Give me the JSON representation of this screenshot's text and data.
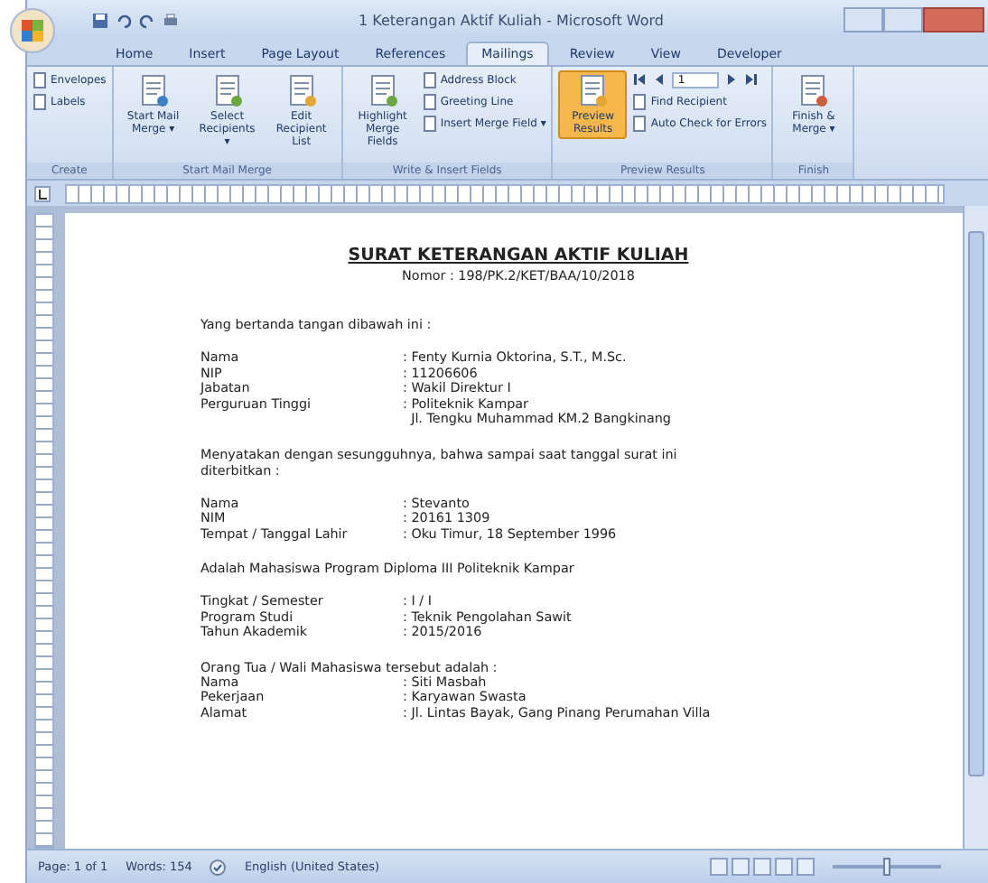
{
  "window": {
    "title": "1 Keterangan Aktif Kuliah - Microsoft Word"
  },
  "tabs": [
    {
      "label": "Home",
      "selected": false
    },
    {
      "label": "Insert",
      "selected": false
    },
    {
      "label": "Page Layout",
      "selected": false
    },
    {
      "label": "References",
      "selected": false
    },
    {
      "label": "Mailings",
      "selected": true
    },
    {
      "label": "Review",
      "selected": false
    },
    {
      "label": "View",
      "selected": false
    },
    {
      "label": "Developer",
      "selected": false
    }
  ],
  "ribbon_groups": [
    {
      "label": "Create",
      "items": [
        {
          "kind": "small",
          "label": "Envelopes"
        },
        {
          "kind": "small",
          "label": "Labels"
        }
      ]
    },
    {
      "label": "Start Mail Merge",
      "items": [
        {
          "kind": "large",
          "label": "Start Mail Merge ▾"
        },
        {
          "kind": "large",
          "label": "Select Recipients ▾"
        },
        {
          "kind": "large",
          "label": "Edit Recipient List"
        }
      ]
    },
    {
      "label": "Write & Insert Fields",
      "items": [
        {
          "kind": "large",
          "label": "Highlight Merge Fields"
        },
        {
          "kind": "stack",
          "items": [
            "Address Block",
            "Greeting Line",
            "Insert Merge Field ▾"
          ]
        }
      ]
    },
    {
      "label": "Preview Results",
      "items": [
        {
          "kind": "active",
          "label": "Preview Results"
        },
        {
          "kind": "nav",
          "record": "1",
          "items": [
            "Find Recipient",
            "Auto Check for Errors"
          ]
        }
      ]
    },
    {
      "label": "Finish",
      "items": [
        {
          "kind": "large",
          "label": "Finish & Merge ▾"
        }
      ]
    }
  ],
  "document": [
    {
      "kind": "heading",
      "text": "SURAT KETERANGAN AKTIF KULIAH"
    },
    {
      "kind": "number",
      "text": "Nomor : 198/PK.2/KET/BAA/10/2018"
    },
    {
      "kind": "para",
      "text": "Yang bertanda tangan dibawah ini :"
    },
    {
      "kind": "fields",
      "rows": [
        {
          "label": "Nama",
          "value": ": Fenty Kurnia Oktorina, S.T., M.Sc."
        },
        {
          "label": "NIP",
          "value": ": 11206606"
        },
        {
          "label": "Jabatan",
          "value": ": Wakil Direktur I"
        },
        {
          "label": "Perguruan Tinggi",
          "value": ": Politeknik Kampar"
        },
        {
          "label": "",
          "value": "  Jl. Tengku Muhammad KM.2 Bangkinang"
        }
      ]
    },
    {
      "kind": "para",
      "text": "Menyatakan dengan sesungguhnya, bahwa sampai saat tanggal surat ini diterbitkan :"
    },
    {
      "kind": "fields",
      "rows": [
        {
          "label": "Nama",
          "value": ": Stevanto"
        },
        {
          "label": "NIM",
          "value": ": 20161 1309"
        },
        {
          "label": "Tempat / Tanggal Lahir",
          "value": ": Oku Timur, 18 September 1996"
        }
      ]
    },
    {
      "kind": "para",
      "text": "Adalah Mahasiswa Program Diploma III Politeknik Kampar"
    },
    {
      "kind": "fields",
      "rows": [
        {
          "label": "Tingkat / Semester",
          "value": ": I / I"
        },
        {
          "label": "Program Studi",
          "value": ": Teknik Pengolahan Sawit"
        },
        {
          "label": "Tahun Akademik",
          "value": ": 2015/2016"
        }
      ]
    },
    {
      "kind": "tight",
      "text": "Orang Tua / Wali Mahasiswa tersebut adalah :"
    },
    {
      "kind": "fields",
      "rows": [
        {
          "label": "Nama",
          "value": ": Siti Masbah"
        },
        {
          "label": "Pekerjaan",
          "value": ": Karyawan Swasta"
        },
        {
          "label": "Alamat",
          "value": ": Jl. Lintas Bayak, Gang Pinang Perumahan Villa"
        }
      ]
    }
  ],
  "status_bar": {
    "page": "Page: 1 of 1",
    "words": "Words: 154",
    "language": "English (United States)",
    "zoom": {
      "level": 0.5
    }
  }
}
